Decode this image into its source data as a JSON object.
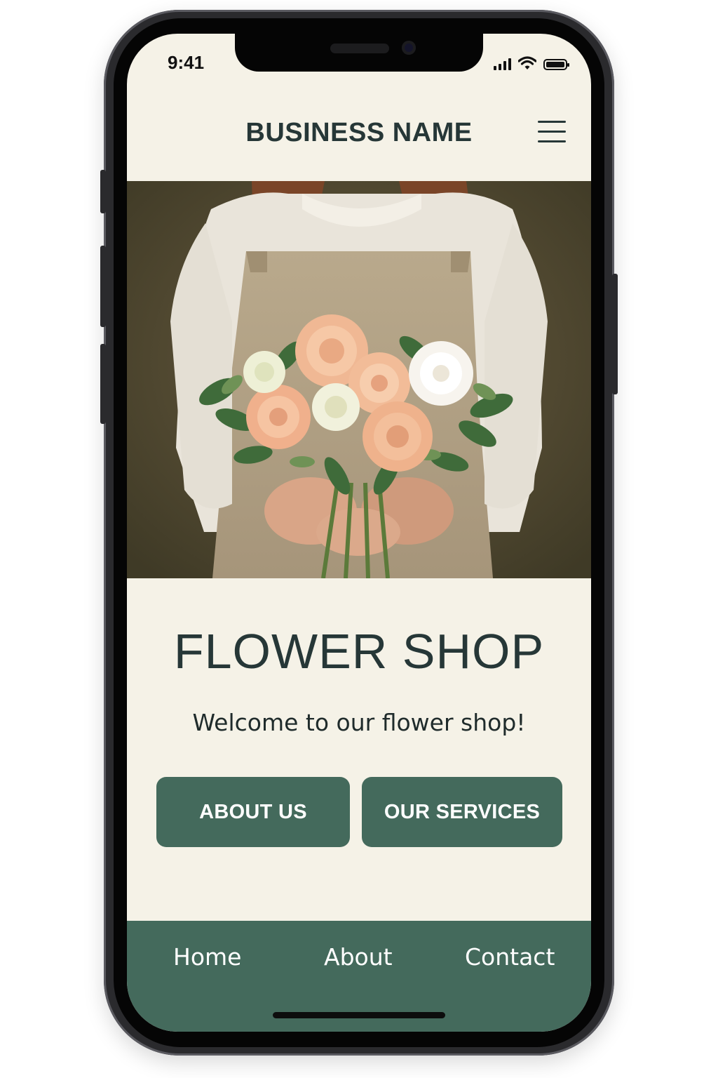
{
  "status_bar": {
    "time": "9:41",
    "icons": [
      "signal-icon",
      "wifi-icon",
      "battery-icon"
    ]
  },
  "header": {
    "brand": "BUSINESS NAME",
    "menu_icon": "hamburger-menu-icon"
  },
  "hero": {
    "image": "person-holding-flower-bouquet"
  },
  "main": {
    "title": "FLOWER SHOP",
    "subtitle": "Welcome to our flower shop!",
    "buttons": [
      {
        "label": "ABOUT US"
      },
      {
        "label": "OUR SERVICES"
      }
    ]
  },
  "bottom_nav": {
    "items": [
      {
        "label": "Home"
      },
      {
        "label": "About"
      },
      {
        "label": "Contact"
      }
    ]
  },
  "colors": {
    "background": "#f5f2e7",
    "accent": "#446a5c",
    "text": "#263737"
  }
}
